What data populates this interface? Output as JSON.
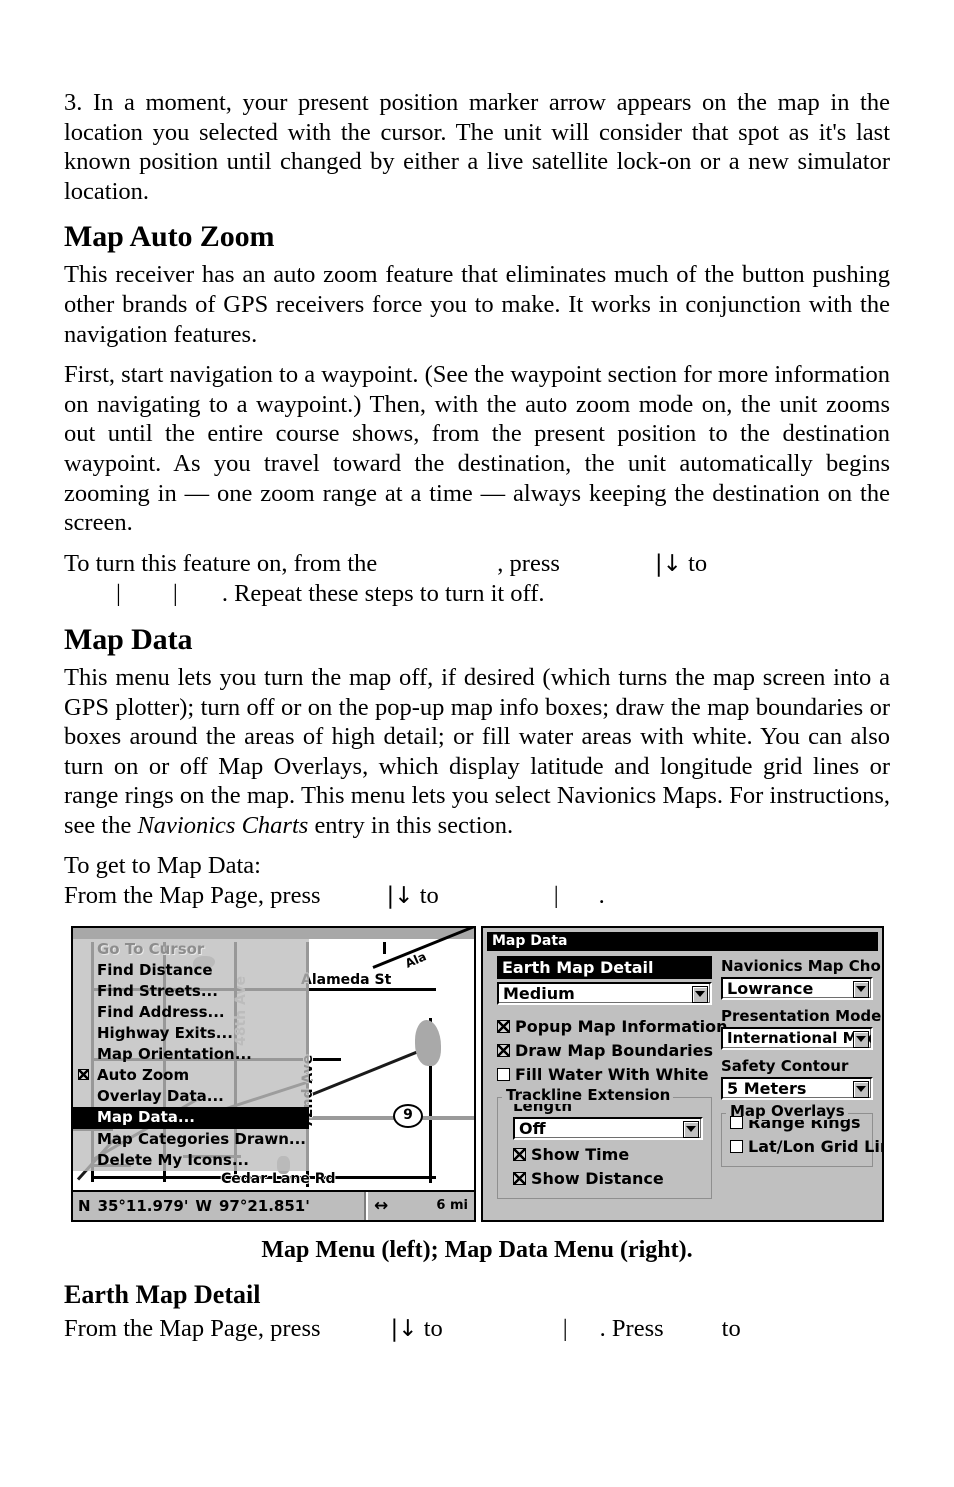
{
  "document": {
    "paragraph_3": "3. In a moment, your present position marker arrow appears on the map in the location you selected with the cursor. The unit will consider that spot as it's last known position until changed by either a live satellite lock-on or a new simulator location.",
    "heading_auto_zoom": "Map Auto Zoom",
    "auto_zoom_p1": "This receiver has an auto zoom feature that eliminates much of the button pushing other brands of GPS receivers force you to make. It works in conjunction with the navigation features.",
    "auto_zoom_p2": "First, start navigation to a waypoint. (See the waypoint section for more information on navigating to a waypoint.) Then, with the auto zoom mode on, the unit zooms out until the entire course shows, from the present position to the destination waypoint. As you travel toward the destination, the unit automatically begins zooming in — one zoom range at a time — always keeping the destination on the screen.",
    "instruction_autozoom": {
      "part1": "To  turn  this  feature  on,  from  the",
      "part2": ",  press",
      "key": "|↓",
      "part3": "to",
      "pipe1": "|",
      "pipe2": "|",
      "part4": ". Repeat these steps to turn it off."
    },
    "heading_map_data": "Map Data",
    "map_data_p1_a": "This menu lets you turn the map off, if desired (which turns the map screen into a GPS plotter); turn off or on the pop-up map info boxes; draw the map boundaries or boxes around the areas of high detail; or fill water areas with white. You can also turn on or off Map Overlays, which display latitude and longitude grid lines or range rings on the map. This menu lets you select Navionics Maps. For instructions, see the ",
    "map_data_p1_italic": "Navionics Charts",
    "map_data_p1_b": " entry in this section.",
    "to_get_to": "To get to Map Data:",
    "instruction_mapdata": {
      "part1": "From the Map Page, press",
      "key": "|↓",
      "part2": "to",
      "pipe": "|",
      "part3": "."
    },
    "figure_caption": "Map Menu (left); Map Data Menu (right).",
    "heading_earth_map_detail": "Earth Map Detail",
    "instruction_earth": {
      "part1": "From  the  Map  Page,  press",
      "key": "|↓",
      "part2": "to",
      "pipe": "|",
      "part3": ".  Press",
      "part4": "to"
    }
  },
  "map_menu": {
    "items": [
      {
        "label": "Go To Cursor",
        "state": "disabled",
        "checkbox": "none"
      },
      {
        "label": "Find Distance",
        "state": "normal",
        "checkbox": "none"
      },
      {
        "label": "Find Streets...",
        "state": "normal",
        "checkbox": "none"
      },
      {
        "label": "Find Address...",
        "state": "normal",
        "checkbox": "none"
      },
      {
        "label": "Highway Exits...",
        "state": "normal",
        "checkbox": "none"
      },
      {
        "label": "Map Orientation...",
        "state": "normal",
        "checkbox": "none"
      },
      {
        "label": "Auto Zoom",
        "state": "normal",
        "checkbox": "checked"
      },
      {
        "label": "Overlay Data...",
        "state": "normal",
        "checkbox": "none"
      },
      {
        "label": "Map Data...",
        "state": "selected",
        "checkbox": "none"
      },
      {
        "label": "Map Categories Drawn...",
        "state": "normal",
        "checkbox": "none"
      },
      {
        "label": "Delete My Icons...",
        "state": "normal",
        "checkbox": "none"
      }
    ],
    "map_labels": {
      "alameda": "Alameda St",
      "diagonal": "Ala",
      "ave72": "72nd Ave",
      "ave48": "48th Ave",
      "cedar": "Cedar Lane Rd",
      "shield": "9"
    },
    "status_bar": {
      "lat_hemisphere": "N",
      "latitude": "35°11.979'",
      "lon_hemisphere": "W",
      "longitude": "97°21.851'",
      "scale": "6 mi"
    }
  },
  "map_data_dialog": {
    "title": "Map Data",
    "left_column": {
      "earth_map_detail_header": "Earth Map Detail",
      "earth_map_detail_value": "Medium",
      "checkboxes": [
        {
          "label": "Popup Map Information",
          "checked": true
        },
        {
          "label": "Draw Map Boundaries",
          "checked": true
        },
        {
          "label": "Fill Water With White",
          "checked": false
        }
      ],
      "trackline_group": {
        "title": "Trackline Extension",
        "length_label": "Length",
        "length_value": "Off",
        "checkboxes": [
          {
            "label": "Show Time",
            "checked": true
          },
          {
            "label": "Show Distance",
            "checked": true
          }
        ]
      }
    },
    "right_column": {
      "navionics_label": "Navionics Map Choice",
      "navionics_value": "Lowrance",
      "presentation_label": "Presentation Mode",
      "presentation_value": "International Mode",
      "safety_label": "Safety Contour",
      "safety_value": "5 Meters",
      "overlays_group": {
        "title": "Map Overlays",
        "checkboxes": [
          {
            "label": "Range Rings",
            "checked": false
          },
          {
            "label": "Lat/Lon Grid Lines",
            "checked": false
          }
        ]
      }
    }
  }
}
